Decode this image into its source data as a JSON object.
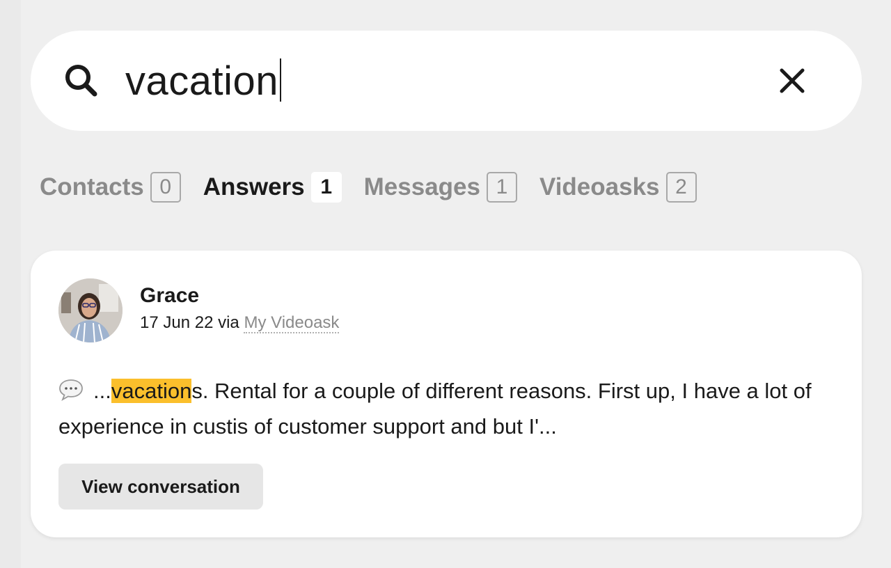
{
  "search": {
    "value": "vacation",
    "placeholder": ""
  },
  "tabs": [
    {
      "label": "Contacts",
      "count": "0",
      "active": false
    },
    {
      "label": "Answers",
      "count": "1",
      "active": true
    },
    {
      "label": "Messages",
      "count": "1",
      "active": false
    },
    {
      "label": "Videoasks",
      "count": "2",
      "active": false
    }
  ],
  "result": {
    "contact_name": "Grace",
    "date": "17 Jun 22",
    "via_label": "via",
    "source_link": "My Videoask",
    "snippet_prefix": "...",
    "snippet_highlight": "vacation",
    "snippet_rest": "s. Rental for a couple of different reasons. First up, I have a lot of experience in custis of customer support and but I'...",
    "button_label": "View conversation"
  },
  "colors": {
    "background": "#efefef",
    "card": "#ffffff",
    "highlight": "#fbbf2c",
    "muted": "#8a8a8a"
  }
}
